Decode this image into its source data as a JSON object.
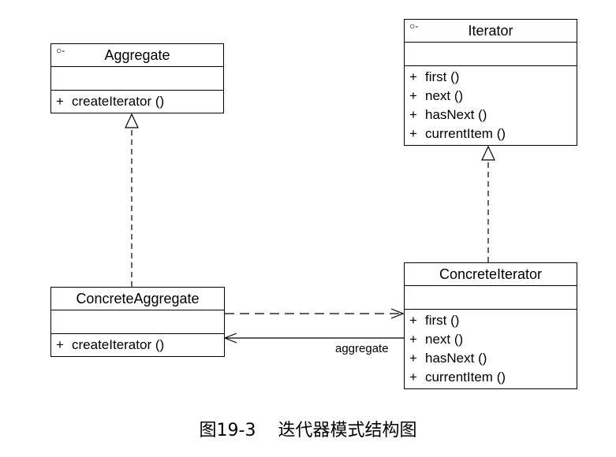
{
  "classes": {
    "aggregate": {
      "interface_mark": "○-",
      "name": "Aggregate",
      "operations": [
        {
          "vis": "+",
          "label": "createIterator ()"
        }
      ]
    },
    "iterator": {
      "interface_mark": "○-",
      "name": "Iterator",
      "operations": [
        {
          "vis": "+",
          "label": "first ()"
        },
        {
          "vis": "+",
          "label": "next ()"
        },
        {
          "vis": "+",
          "label": "hasNext ()"
        },
        {
          "vis": "+",
          "label": "currentItem ()"
        }
      ]
    },
    "concrete_aggregate": {
      "name": "ConcreteAggregate",
      "operations": [
        {
          "vis": "+",
          "label": "createIterator ()"
        }
      ]
    },
    "concrete_iterator": {
      "name": "ConcreteIterator",
      "operations": [
        {
          "vis": "+",
          "label": "first ()"
        },
        {
          "vis": "+",
          "label": "next ()"
        },
        {
          "vis": "+",
          "label": "hasNext ()"
        },
        {
          "vis": "+",
          "label": "currentItem ()"
        }
      ]
    }
  },
  "association": {
    "label": "aggregate"
  },
  "caption": {
    "number": "图19-3",
    "title": "迭代器模式结构图"
  }
}
